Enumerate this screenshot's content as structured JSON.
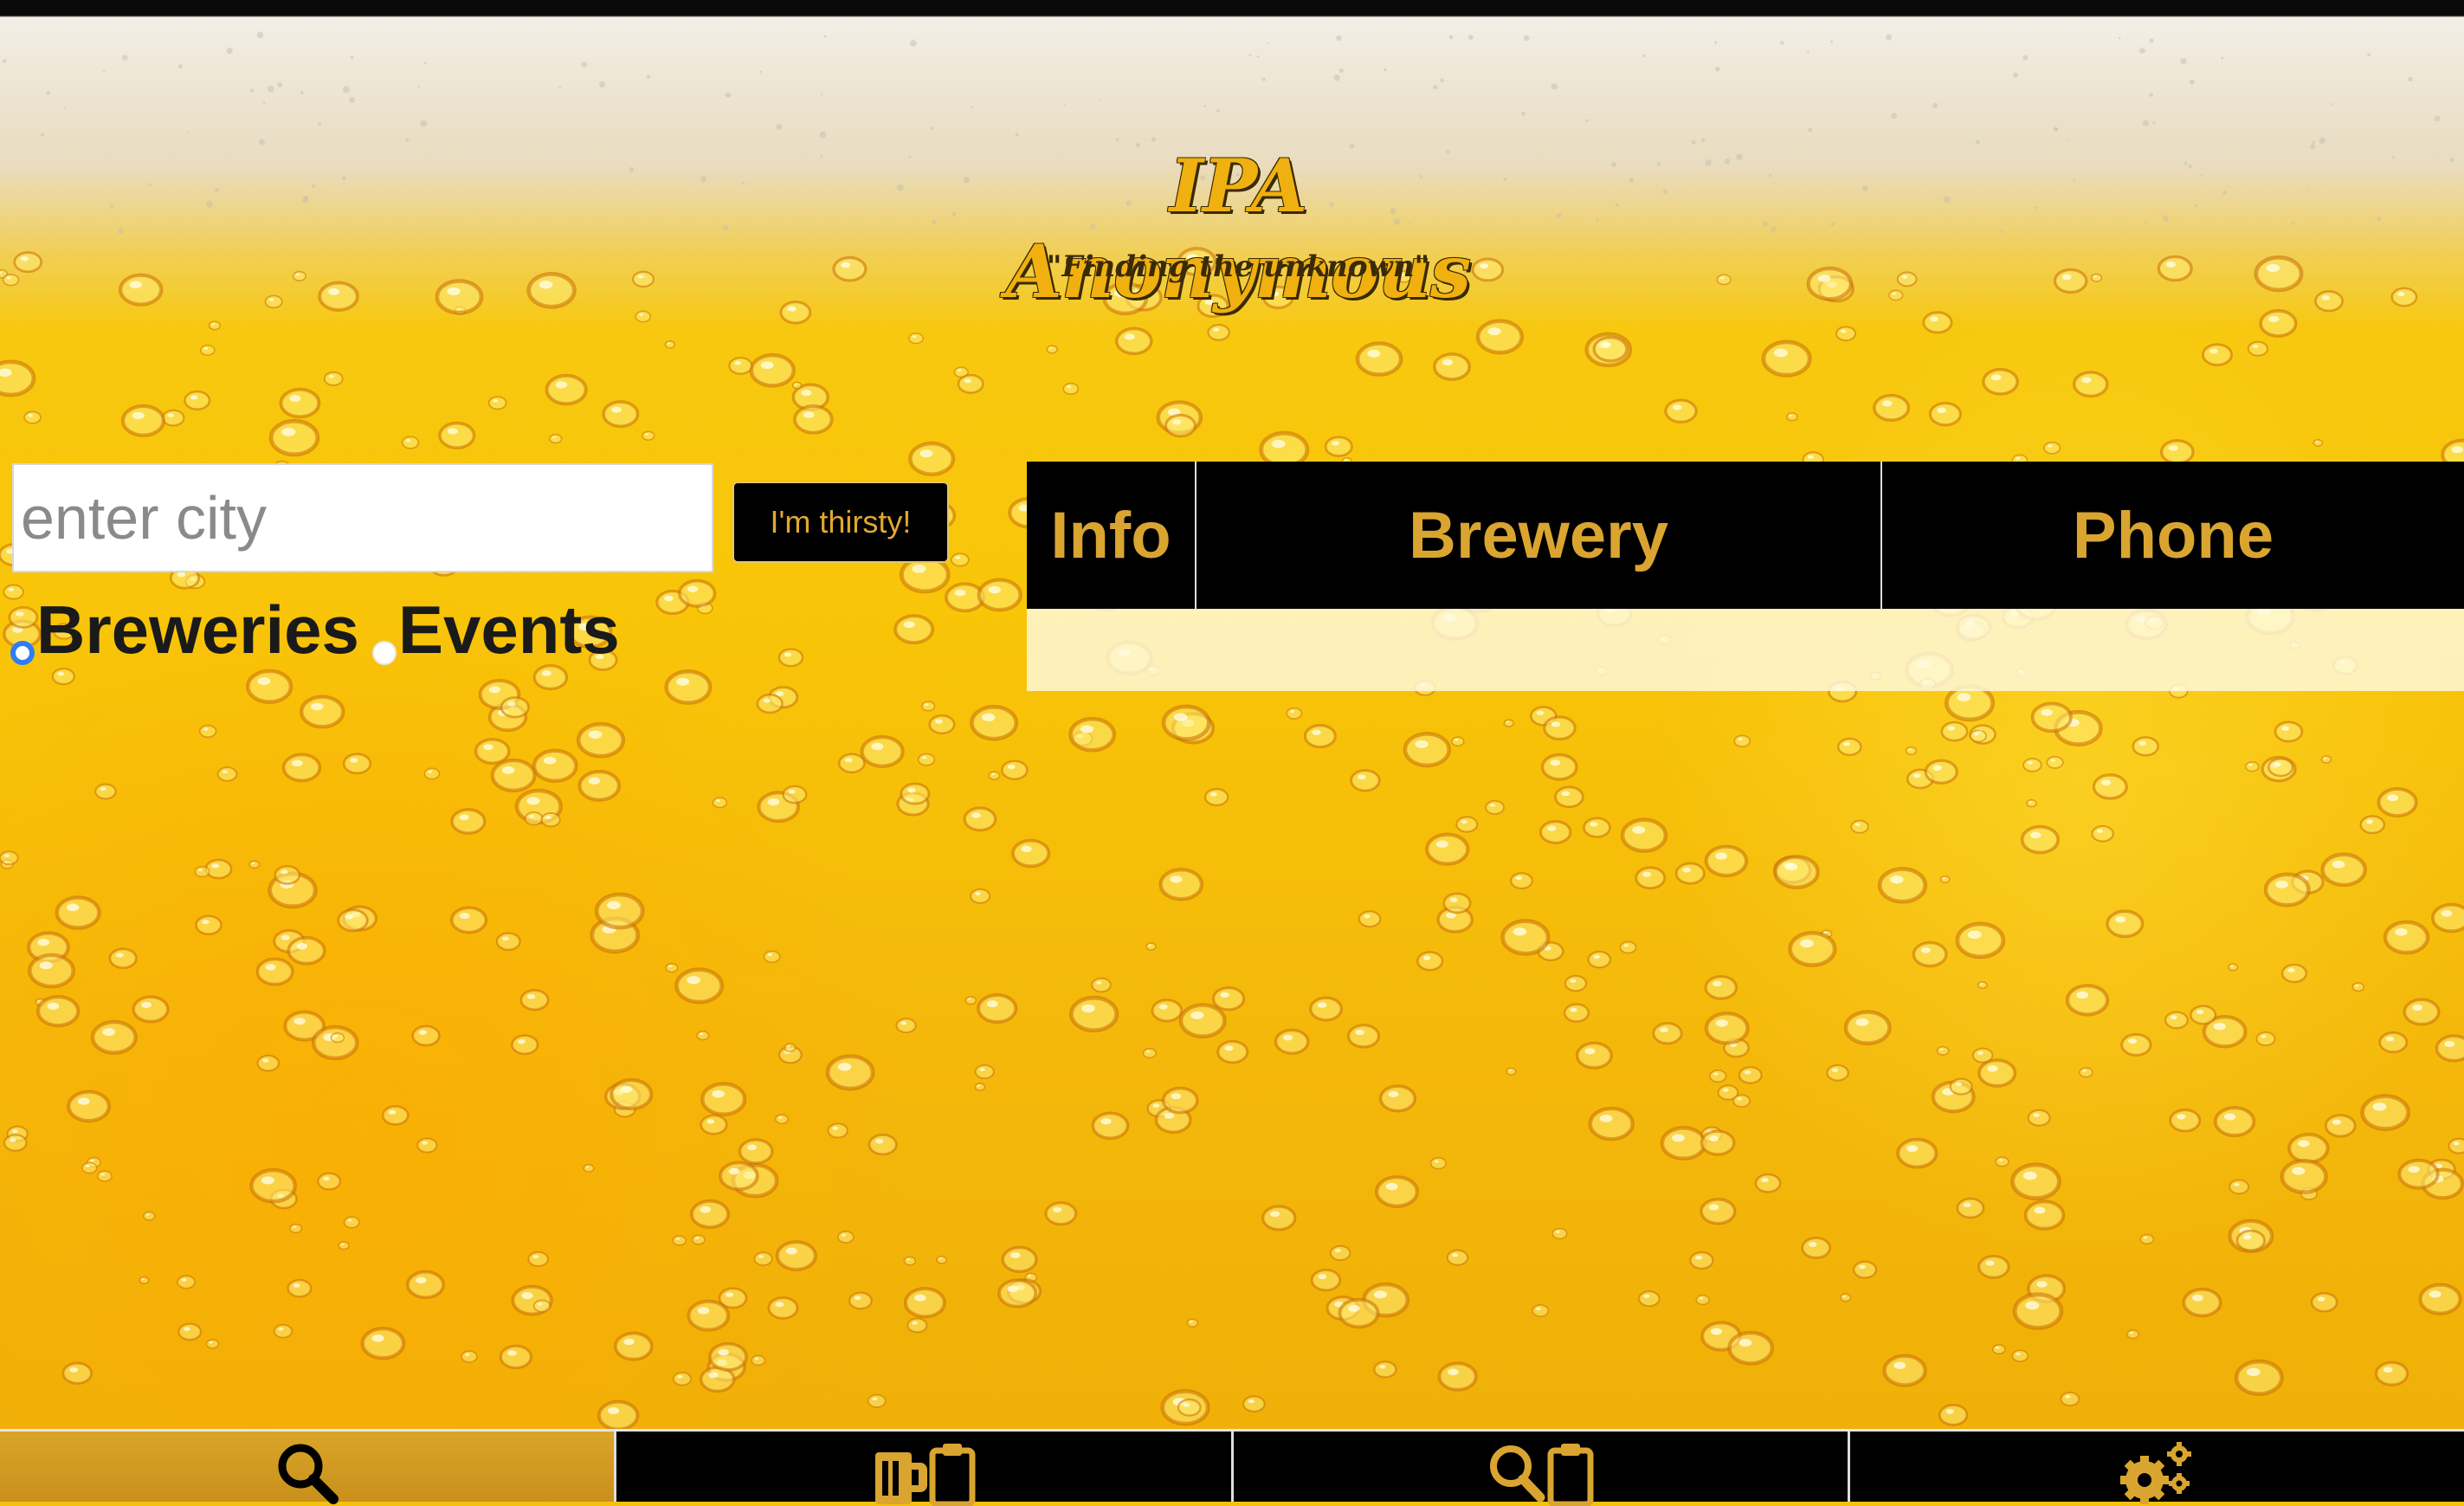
{
  "header": {
    "title": "IPA Anonymous",
    "subtitle": "\"Finding the unknown\""
  },
  "search": {
    "placeholder": "enter city",
    "value": "",
    "button_label": "I'm thirsty!"
  },
  "filters": {
    "options": [
      {
        "label": "Breweries",
        "checked": true
      },
      {
        "label": "Events",
        "checked": false
      }
    ]
  },
  "results": {
    "columns": [
      "Info",
      "Brewery",
      "Phone"
    ],
    "rows": []
  },
  "nav": {
    "tabs": [
      {
        "icon": "search-icon",
        "active": true
      },
      {
        "icon": "beer-clipboard-icon",
        "active": false
      },
      {
        "icon": "search-clipboard-icon",
        "active": false
      },
      {
        "icon": "gears-icon",
        "active": false
      }
    ]
  },
  "colors": {
    "accent_gold": "#d9a530",
    "nav_active": "#d0982a",
    "black": "#000000",
    "radio_selected": "#2f7df6"
  }
}
